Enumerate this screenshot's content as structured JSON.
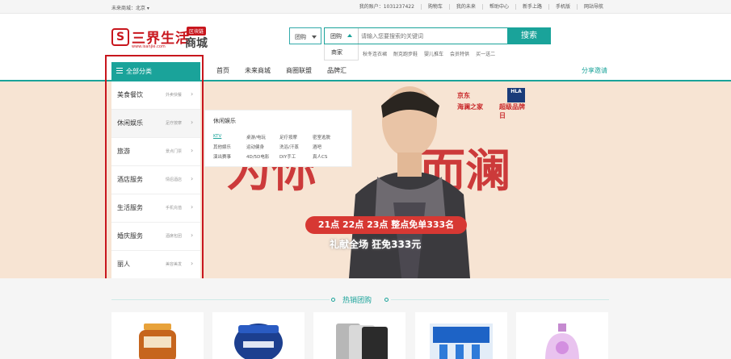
{
  "topbar": {
    "location": "未来商城：北京 ▾",
    "links": [
      "我的账户：1031237422",
      "购物车",
      "我的未来",
      "帮助中心",
      "新手上路",
      "手机版",
      "网站导航"
    ]
  },
  "logo": {
    "name": "三界生活",
    "mall": "商城",
    "tag": "区块链",
    "url": "www.isanjie.com"
  },
  "search": {
    "outer_type": "团购",
    "inner_type": "团购",
    "placeholder": "请输入您要搜索的关键词",
    "button": "搜索",
    "dropdown_option": "商家",
    "hot_words": [
      "秋冬连衣裙",
      "耐克跑步鞋",
      "婴儿推车",
      "会员特供",
      "买一送二"
    ]
  },
  "nav": {
    "all_categories": "全部分类",
    "items": [
      "首页",
      "未来商城",
      "商圈联盟",
      "品牌汇"
    ],
    "share": "分享邀请"
  },
  "categories": [
    {
      "label": "美食餐饮",
      "sub": "外卖快餐"
    },
    {
      "label": "休闲娱乐",
      "sub": "足疗按摩"
    },
    {
      "label": "旅游",
      "sub": "景点门票"
    },
    {
      "label": "酒店服务",
      "sub": "情侣酒店"
    },
    {
      "label": "生活服务",
      "sub": "手机充值"
    },
    {
      "label": "婚庆服务",
      "sub": "酒席包团"
    },
    {
      "label": "丽人",
      "sub": "美容美发"
    }
  ],
  "flyout": {
    "title": "休闲娱乐",
    "items": [
      "KTV",
      "桌游/电玩",
      "足疗按摩",
      "密室逃脱",
      "其他娱乐",
      "运动健身",
      "洗浴/汗蒸",
      "酒吧",
      "演出赛事",
      "4D/5D电影",
      "DIY手工",
      "真人CS"
    ]
  },
  "banner": {
    "brush_left": "为你",
    "brush_right": "而澜",
    "brand_top": "京东",
    "brand_label": "超级品牌日",
    "brand_label2": "海澜之家",
    "brand_label3": "超级品牌日",
    "hla": "HLA",
    "promo_line1": "21点 22点 23点 整点免单333名",
    "promo_line2": "礼献全场 狂免333元"
  },
  "hot": {
    "title": "热销团购"
  }
}
